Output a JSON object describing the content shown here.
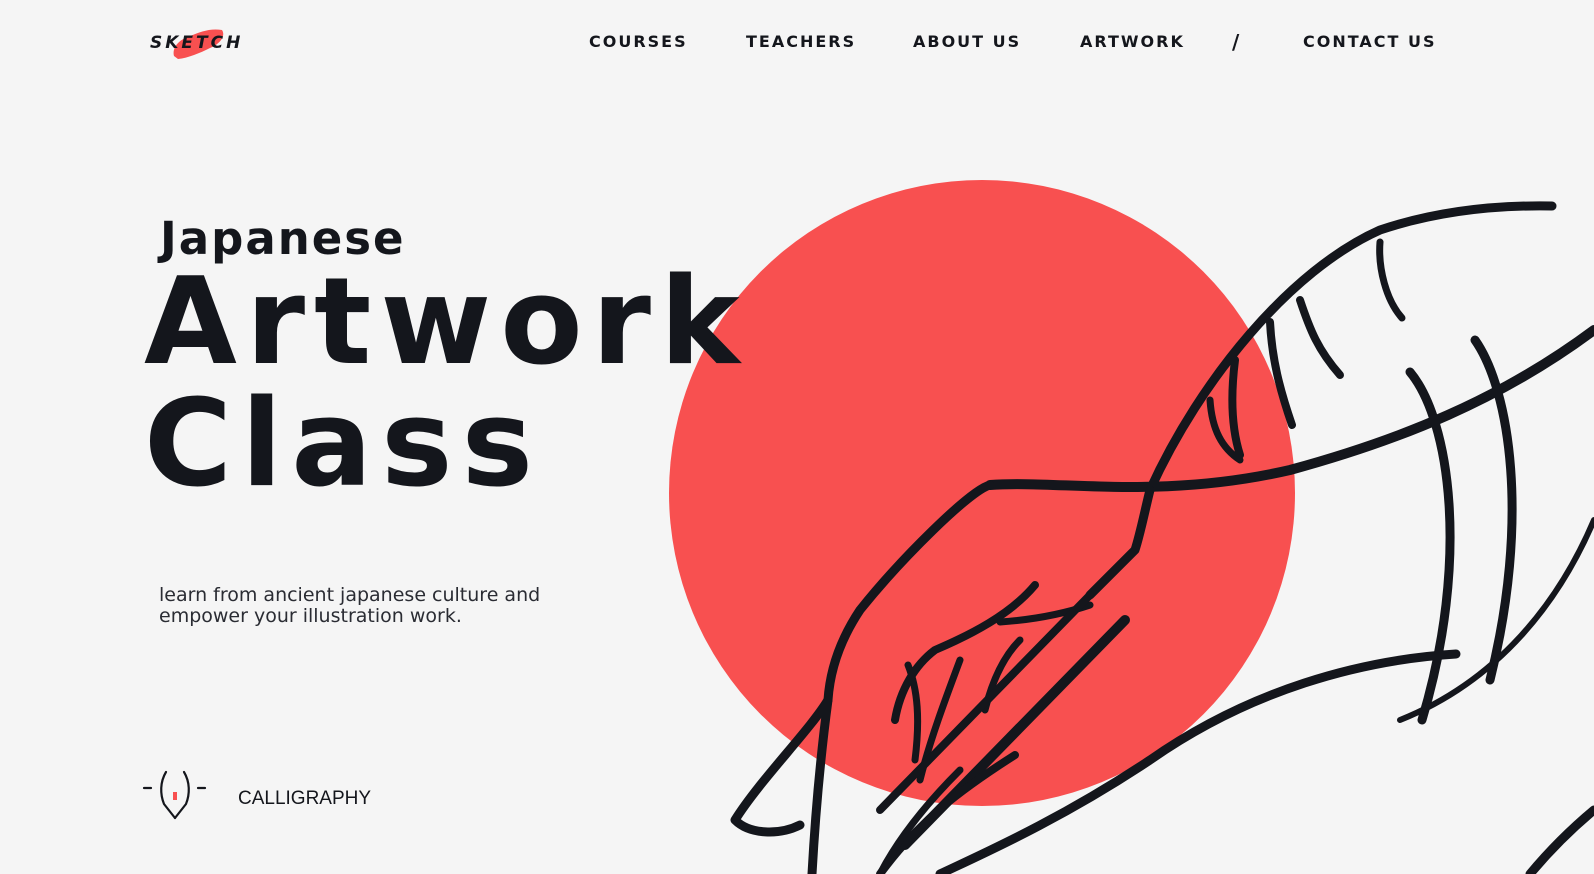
{
  "brand": {
    "logo_text": "SKETCH",
    "accent_color": "#f85050",
    "ink_color": "#14161c",
    "background_color": "#f5f5f5"
  },
  "nav": {
    "items": [
      {
        "label": "COURSES"
      },
      {
        "label": "TEACHERS"
      },
      {
        "label": "ABOUT US"
      },
      {
        "label": "ARTWORK"
      },
      {
        "label": "CONTACT US"
      }
    ],
    "separator": "/"
  },
  "hero": {
    "subtitle": "Japanese",
    "title_line1": "Artwork",
    "title_line2": "Class",
    "description": "learn from ancient japanese culture and empower your illustration work."
  },
  "feature": {
    "icon": "pen-nib-icon",
    "label": "CALLIGRAPHY"
  },
  "illustration": {
    "icon": "hand-holding-brush-illustration"
  }
}
